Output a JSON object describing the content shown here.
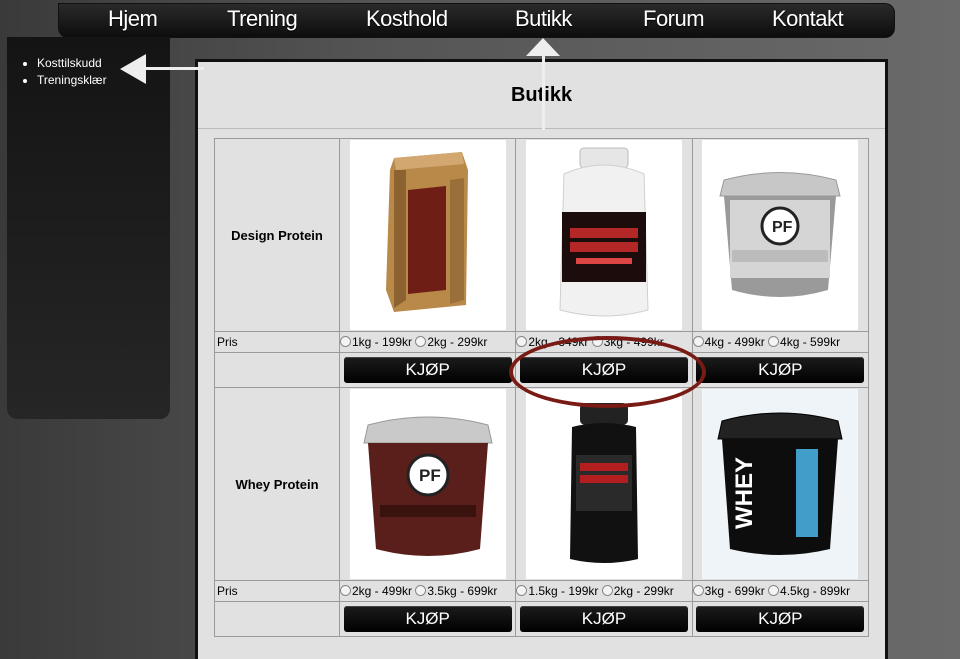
{
  "nav": {
    "items": [
      "Hjem",
      "Trening",
      "Kosthold",
      "Butikk",
      "Forum",
      "Kontakt"
    ]
  },
  "sidebar": {
    "items": [
      "Kosttilskudd",
      "Treningsklær"
    ]
  },
  "page": {
    "title": "Butikk"
  },
  "price_label": "Pris",
  "buy_label": "KJØP",
  "categories": [
    {
      "name": "Design Protein",
      "products": [
        {
          "image": "gold-bag-product",
          "options": [
            "1kg - 199kr",
            "2kg - 299kr"
          ]
        },
        {
          "image": "pure-mammut-tub",
          "options": [
            "2kg - 349kr",
            "3kg - 499kr"
          ]
        },
        {
          "image": "whey-tech-bucket-white",
          "options": [
            "4kg - 499kr",
            "4kg - 599kr"
          ]
        }
      ]
    },
    {
      "name": "Whey Protein",
      "products": [
        {
          "image": "whey-tech-bucket-brown",
          "options": [
            "2kg - 499kr",
            "3.5kg - 699kr"
          ]
        },
        {
          "image": "black-tub",
          "options": [
            "1.5kg - 199kr",
            "2kg - 299kr"
          ]
        },
        {
          "image": "micro-whey-bucket",
          "options": [
            "3kg - 699kr",
            "4.5kg - 899kr"
          ]
        }
      ]
    }
  ],
  "colors": {
    "annotation_ellipse": "#7a1a14",
    "arrow": "#eeeeee"
  }
}
